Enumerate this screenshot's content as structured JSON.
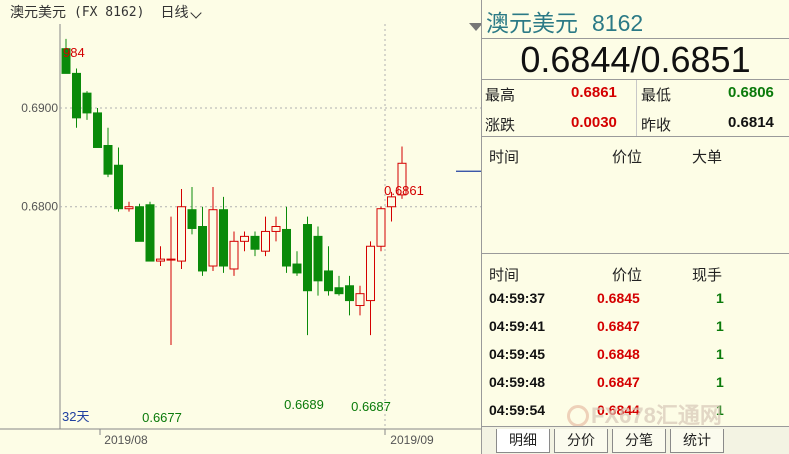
{
  "chart_header": {
    "name": "澳元美元",
    "symbol": "(FX 8162)",
    "period": "日线"
  },
  "chart_labels": {
    "y_ticks": [
      "0.6900",
      "0.6800"
    ],
    "x_ticks": [
      "2019/08",
      "2019/09"
    ],
    "days": "32天",
    "hi_label": "984",
    "annotations": [
      "0.6677",
      "0.6689",
      "0.6687",
      "0.6861"
    ]
  },
  "chart_data": {
    "type": "candlestick",
    "ylim": [
      0.6575,
      0.6985
    ],
    "y_ticks": [
      0.69,
      0.68
    ],
    "x_ticks": [
      "2019/08",
      "2019/09"
    ],
    "candles": [
      {
        "o": 0.696,
        "h": 0.697,
        "l": 0.6935,
        "c": 0.6935
      },
      {
        "o": 0.6935,
        "h": 0.694,
        "l": 0.688,
        "c": 0.689
      },
      {
        "o": 0.6915,
        "h": 0.6917,
        "l": 0.6888,
        "c": 0.6895
      },
      {
        "o": 0.6895,
        "h": 0.69,
        "l": 0.686,
        "c": 0.686
      },
      {
        "o": 0.6862,
        "h": 0.688,
        "l": 0.683,
        "c": 0.6833
      },
      {
        "o": 0.6842,
        "h": 0.686,
        "l": 0.6795,
        "c": 0.6798
      },
      {
        "o": 0.6798,
        "h": 0.6805,
        "l": 0.6795,
        "c": 0.68
      },
      {
        "o": 0.68,
        "h": 0.6803,
        "l": 0.6765,
        "c": 0.6765
      },
      {
        "o": 0.6802,
        "h": 0.6805,
        "l": 0.6745,
        "c": 0.6745
      },
      {
        "o": 0.6745,
        "h": 0.676,
        "l": 0.674,
        "c": 0.6747
      },
      {
        "o": 0.6747,
        "h": 0.679,
        "l": 0.666,
        "c": 0.6747
      },
      {
        "o": 0.6745,
        "h": 0.6818,
        "l": 0.6737,
        "c": 0.68
      },
      {
        "o": 0.6797,
        "h": 0.682,
        "l": 0.6772,
        "c": 0.6778
      },
      {
        "o": 0.678,
        "h": 0.68,
        "l": 0.673,
        "c": 0.6735
      },
      {
        "o": 0.674,
        "h": 0.682,
        "l": 0.6735,
        "c": 0.6797
      },
      {
        "o": 0.6797,
        "h": 0.681,
        "l": 0.6733,
        "c": 0.674
      },
      {
        "o": 0.6737,
        "h": 0.6775,
        "l": 0.673,
        "c": 0.6765
      },
      {
        "o": 0.6765,
        "h": 0.6775,
        "l": 0.6755,
        "c": 0.677
      },
      {
        "o": 0.677,
        "h": 0.6775,
        "l": 0.675,
        "c": 0.6757
      },
      {
        "o": 0.6755,
        "h": 0.679,
        "l": 0.675,
        "c": 0.6775
      },
      {
        "o": 0.6775,
        "h": 0.679,
        "l": 0.6765,
        "c": 0.678
      },
      {
        "o": 0.6777,
        "h": 0.68,
        "l": 0.6733,
        "c": 0.674
      },
      {
        "o": 0.6742,
        "h": 0.6755,
        "l": 0.673,
        "c": 0.6733
      },
      {
        "o": 0.6782,
        "h": 0.679,
        "l": 0.667,
        "c": 0.6715
      },
      {
        "o": 0.677,
        "h": 0.678,
        "l": 0.671,
        "c": 0.6725
      },
      {
        "o": 0.6735,
        "h": 0.676,
        "l": 0.671,
        "c": 0.6715
      },
      {
        "o": 0.6718,
        "h": 0.673,
        "l": 0.671,
        "c": 0.6712
      },
      {
        "o": 0.672,
        "h": 0.673,
        "l": 0.669,
        "c": 0.6705
      },
      {
        "o": 0.67,
        "h": 0.672,
        "l": 0.669,
        "c": 0.6712
      },
      {
        "o": 0.6705,
        "h": 0.6765,
        "l": 0.667,
        "c": 0.676
      },
      {
        "o": 0.676,
        "h": 0.68,
        "l": 0.6755,
        "c": 0.6798
      },
      {
        "o": 0.68,
        "h": 0.6815,
        "l": 0.6785,
        "c": 0.681
      },
      {
        "o": 0.6812,
        "h": 0.6861,
        "l": 0.6808,
        "c": 0.6844
      }
    ],
    "last_price": 0.6844
  },
  "quote": {
    "name": "澳元美元",
    "code": "8162",
    "bid_ask": "0.6844/0.6851",
    "high_label": "最高",
    "high_value": "0.6861",
    "low_label": "最低",
    "low_value": "0.6806",
    "change_label": "涨跌",
    "change_value": "0.0030",
    "prev_close_label": "昨收",
    "prev_close_value": "0.6814"
  },
  "big_orders": {
    "headers": [
      "时间",
      "价位",
      "大单"
    ]
  },
  "trades": {
    "headers": [
      "时间",
      "价位",
      "现手"
    ],
    "rows": [
      {
        "time": "04:59:37",
        "price": "0.6845",
        "vol": "1"
      },
      {
        "time": "04:59:41",
        "price": "0.6847",
        "vol": "1"
      },
      {
        "time": "04:59:45",
        "price": "0.6848",
        "vol": "1"
      },
      {
        "time": "04:59:48",
        "price": "0.6847",
        "vol": "1"
      },
      {
        "time": "04:59:54",
        "price": "0.6844",
        "vol": "1"
      }
    ]
  },
  "tabs": [
    "明细",
    "分价",
    "分笔",
    "统计"
  ],
  "watermark": "FX678汇通网",
  "colors": {
    "up": "#d40000",
    "down": "#0a8a0a",
    "grid": "#b0b0b0",
    "title": "#2b7a86"
  }
}
